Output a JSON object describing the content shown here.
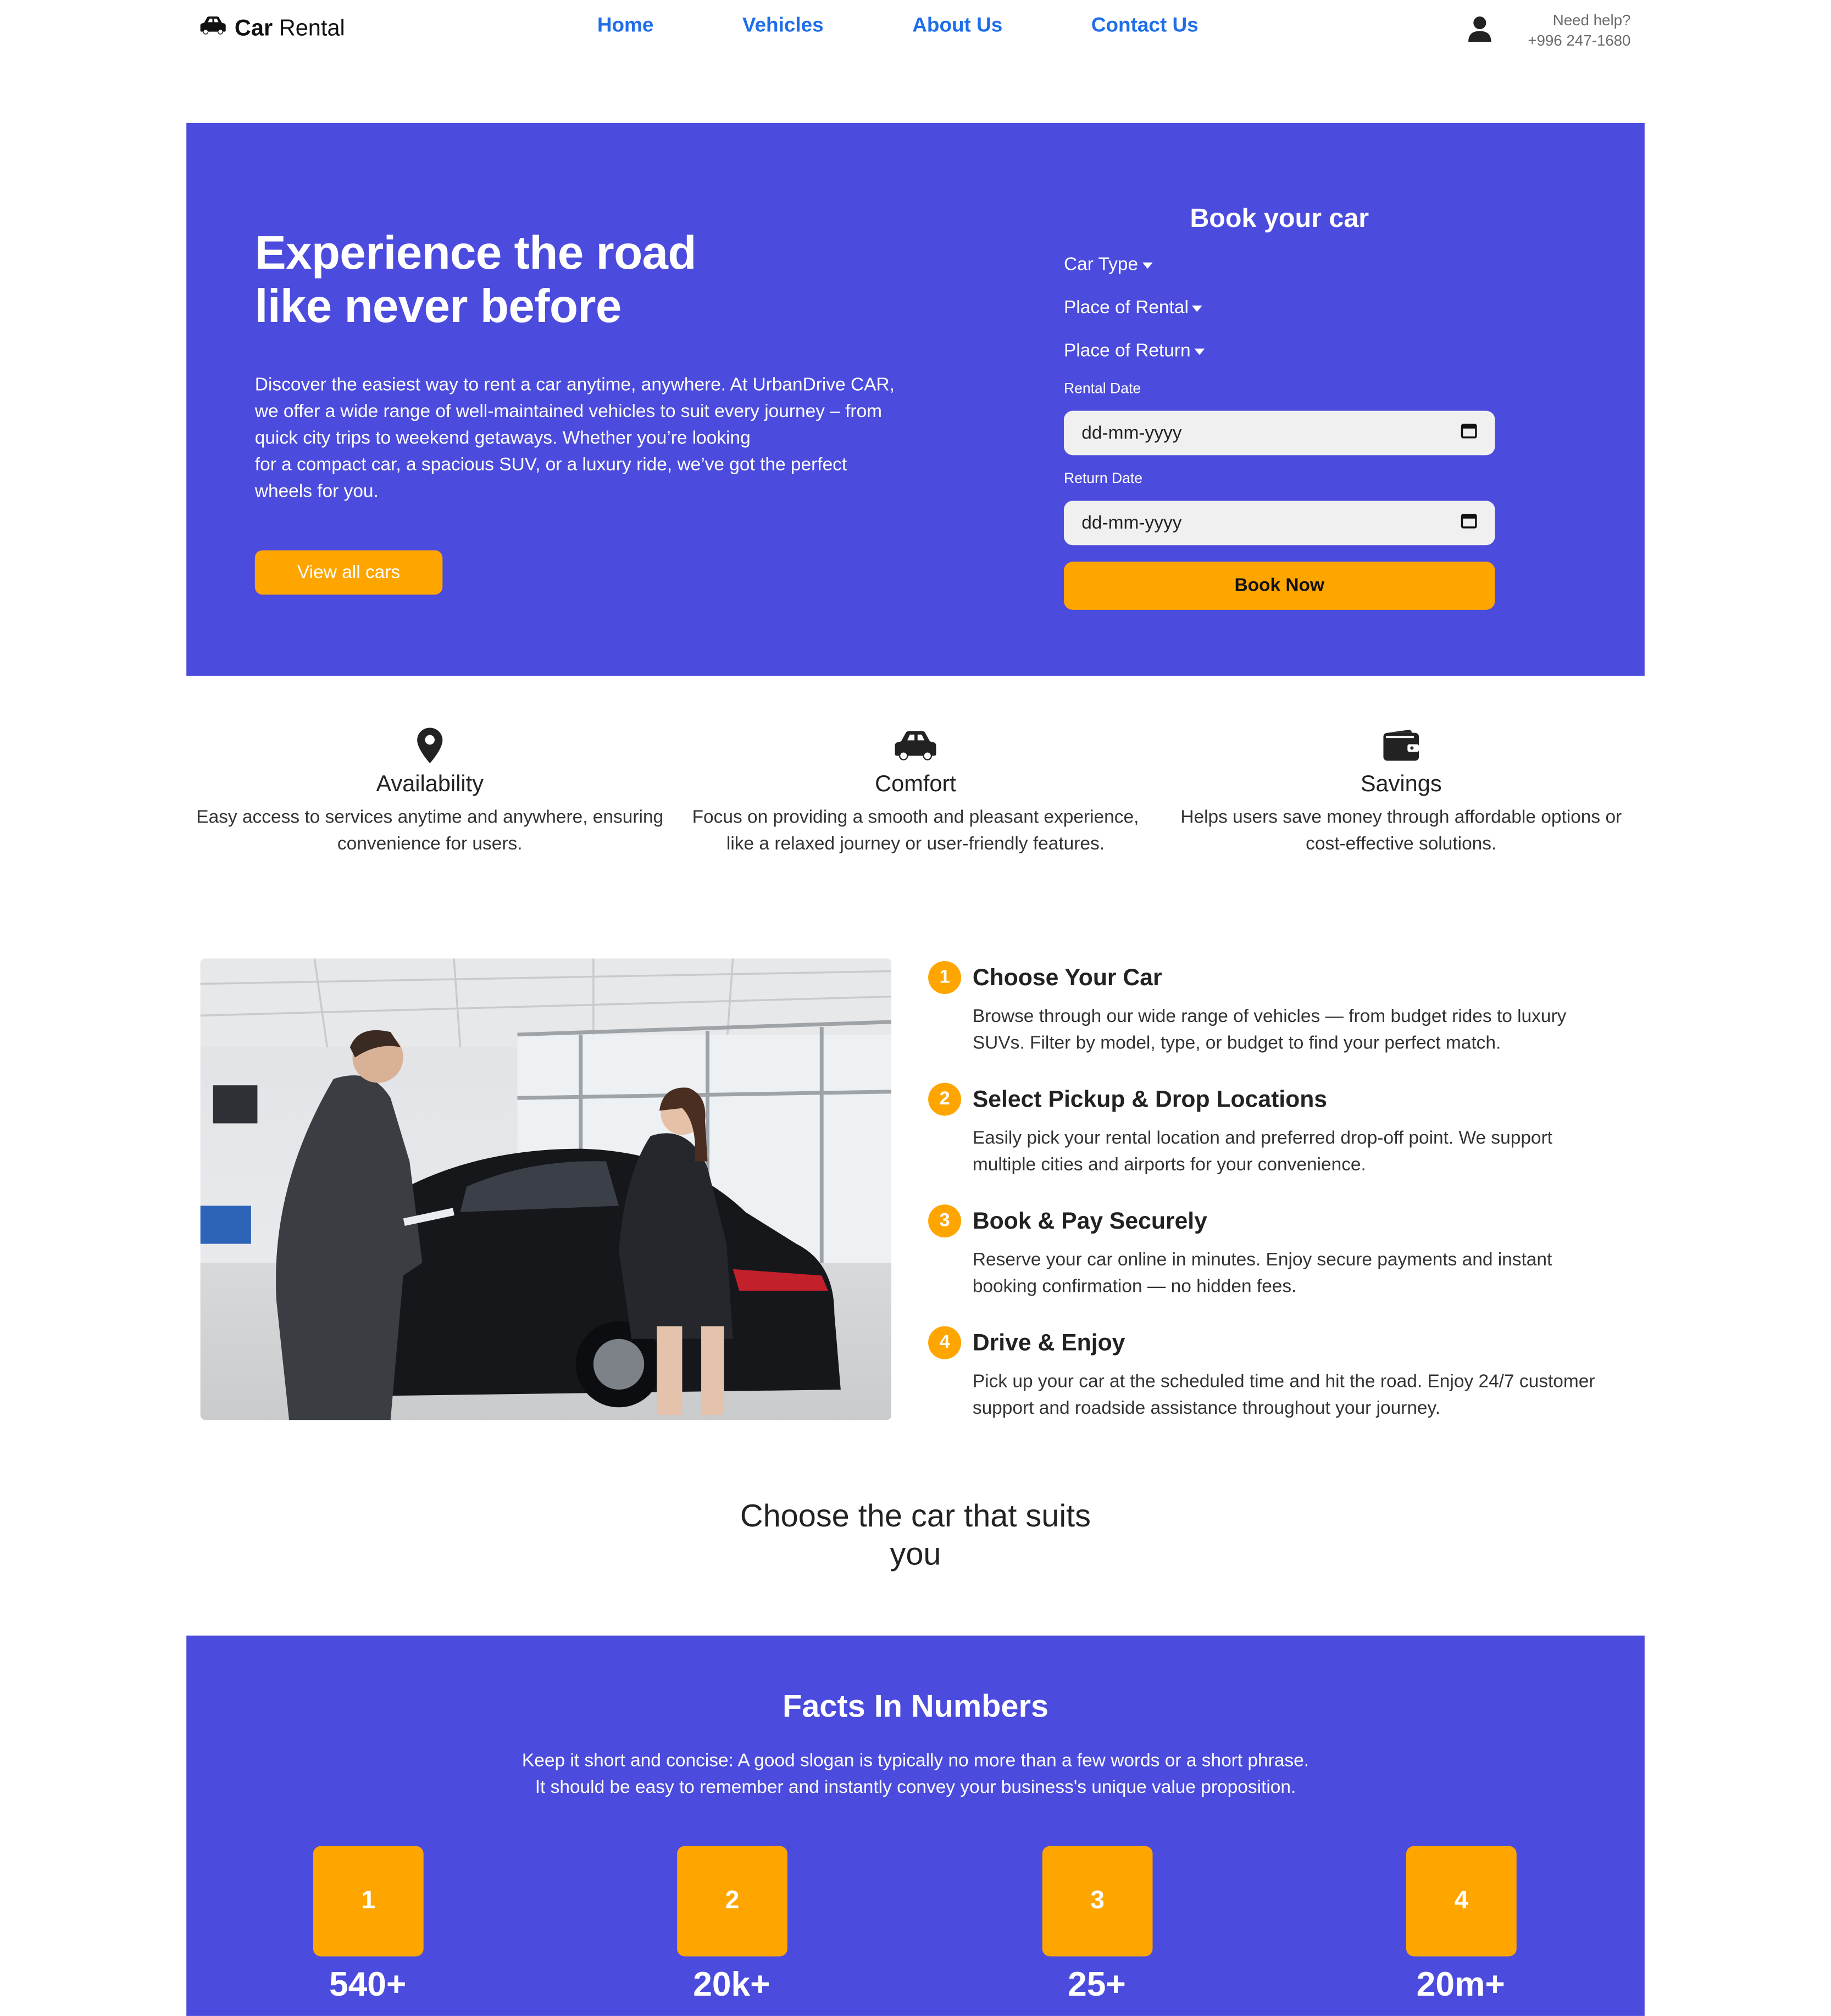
{
  "brand": {
    "bold": "Car",
    "rest": "Rental",
    "icon": "car-icon"
  },
  "nav": [
    "Home",
    "Vehicles",
    "About Us",
    "Contact Us"
  ],
  "help": {
    "label": "Need help?",
    "phone": "+996 247-1680"
  },
  "hero": {
    "title_line1": "Experience the road",
    "title_line2": "like never before",
    "description": "Discover the easiest way to rent a car anytime, anywhere. At UrbanDrive CAR, we offer a wide range of well-maintained vehicles to suit every journey – from quick city trips to weekend getaways. Whether you’re looking\nfor a compact car, a spacious SUV, or a luxury ride, we’ve got the perfect wheels for you.",
    "cta": "View all cars"
  },
  "booking": {
    "title": "Book your car",
    "car_type": "Car Type",
    "place_rental": "Place of Rental",
    "place_return": "Place of Return",
    "rental_date_label": "Rental Date",
    "rental_date_placeholder": "dd-mm-yyyy",
    "return_date_label": "Return Date",
    "return_date_placeholder": "dd-mm-yyyy",
    "submit": "Book Now"
  },
  "features": [
    {
      "icon": "location-pin-icon",
      "title": "Availability",
      "text": "Easy access to services anytime and anywhere, ensuring convenience for users."
    },
    {
      "icon": "car-icon",
      "title": "Comfort",
      "text": "Focus on providing a smooth and pleasant experience,\nlike a relaxed journey or user-friendly features."
    },
    {
      "icon": "wallet-icon",
      "title": "Savings",
      "text": "Helps users save money through affordable options or cost-effective solutions."
    }
  ],
  "steps": [
    {
      "num": "1",
      "title": "Choose Your Car",
      "text": "Browse through our wide range of vehicles — from budget rides to luxury SUVs. Filter by model, type, or budget to find your perfect match."
    },
    {
      "num": "2",
      "title": "Select Pickup & Drop Locations",
      "text": "Easily pick your rental location and preferred drop-off point. We support multiple cities and airports for your convenience."
    },
    {
      "num": "3",
      "title": "Book & Pay Securely",
      "text": "Reserve your car online in minutes. Enjoy secure payments and instant booking confirmation — no hidden fees."
    },
    {
      "num": "4",
      "title": "Drive & Enjoy",
      "text": "Pick up your car at the scheduled time and hit the road. Enjoy 24/7 customer support and roadside assistance throughout your journey."
    }
  ],
  "choose_title": "Choose the car that suits you",
  "facts": {
    "title": "Facts In Numbers",
    "subtitle": "Keep it short and concise: A good slogan is typically no more than a few words or a short phrase.\nIt should be easy to remember and instantly convey your business's unique value proposition.",
    "items": [
      {
        "icon": "1",
        "value": "540+"
      },
      {
        "icon": "2",
        "value": "20k+"
      },
      {
        "icon": "3",
        "value": "25+"
      },
      {
        "icon": "4",
        "value": "20m+"
      }
    ]
  },
  "colors": {
    "primary": "#4b4bdd",
    "accent": "#ffa500",
    "link": "#1f6ee8"
  }
}
